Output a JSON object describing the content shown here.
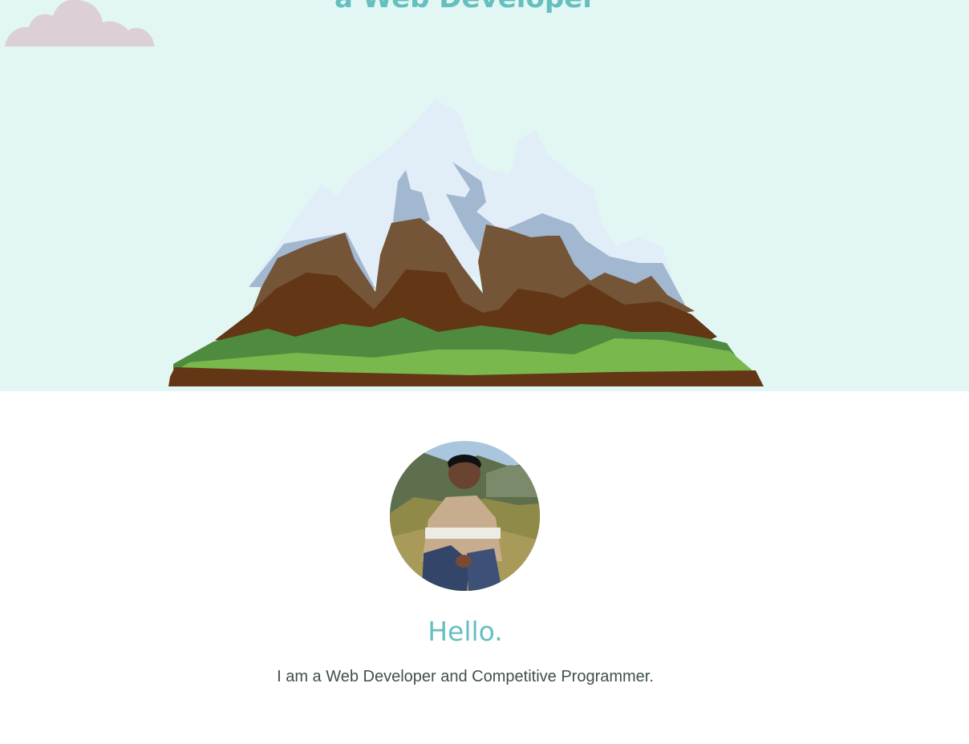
{
  "hero": {
    "subtitle": "a Web Developer",
    "colors": {
      "background": "#e2f7f4",
      "accent": "#66bfbf",
      "cloud": "#ddcfd6"
    },
    "illustrations": [
      "cloud-icon",
      "mountain-icon"
    ]
  },
  "about": {
    "greeting": "Hello.",
    "intro": "I am a Web Developer and Competitive Programmer.",
    "text_color": "#40514e"
  }
}
